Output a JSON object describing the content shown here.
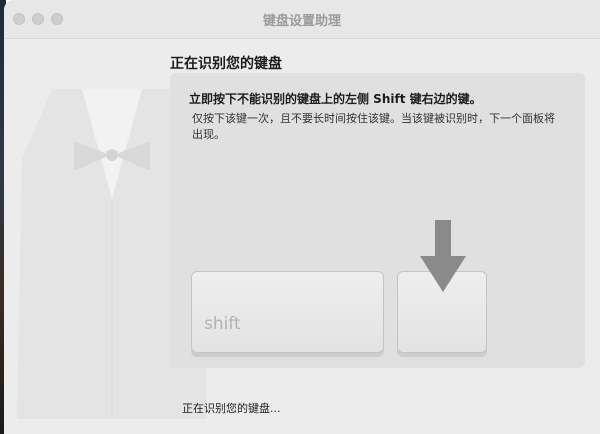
{
  "window": {
    "title": "键盘设置助理"
  },
  "page": {
    "heading": "正在识别您的键盘",
    "instruction": "立即按下不能识别的键盘上的左侧 Shift 键右边的键。",
    "detail": "仅按下该键一次，且不要长时间按住该键。当该键被识别时，下一个面板将出现。",
    "status": "正在识别您的键盘..."
  },
  "keys": {
    "shift_label": "shift"
  },
  "icons": {
    "arrow": "down-arrow-icon",
    "watermark": "tuxedo-icon"
  },
  "colors": {
    "window_bg": "#ececec",
    "panel_bg": "#e0e0e0",
    "arrow": "#8a8a8a"
  }
}
